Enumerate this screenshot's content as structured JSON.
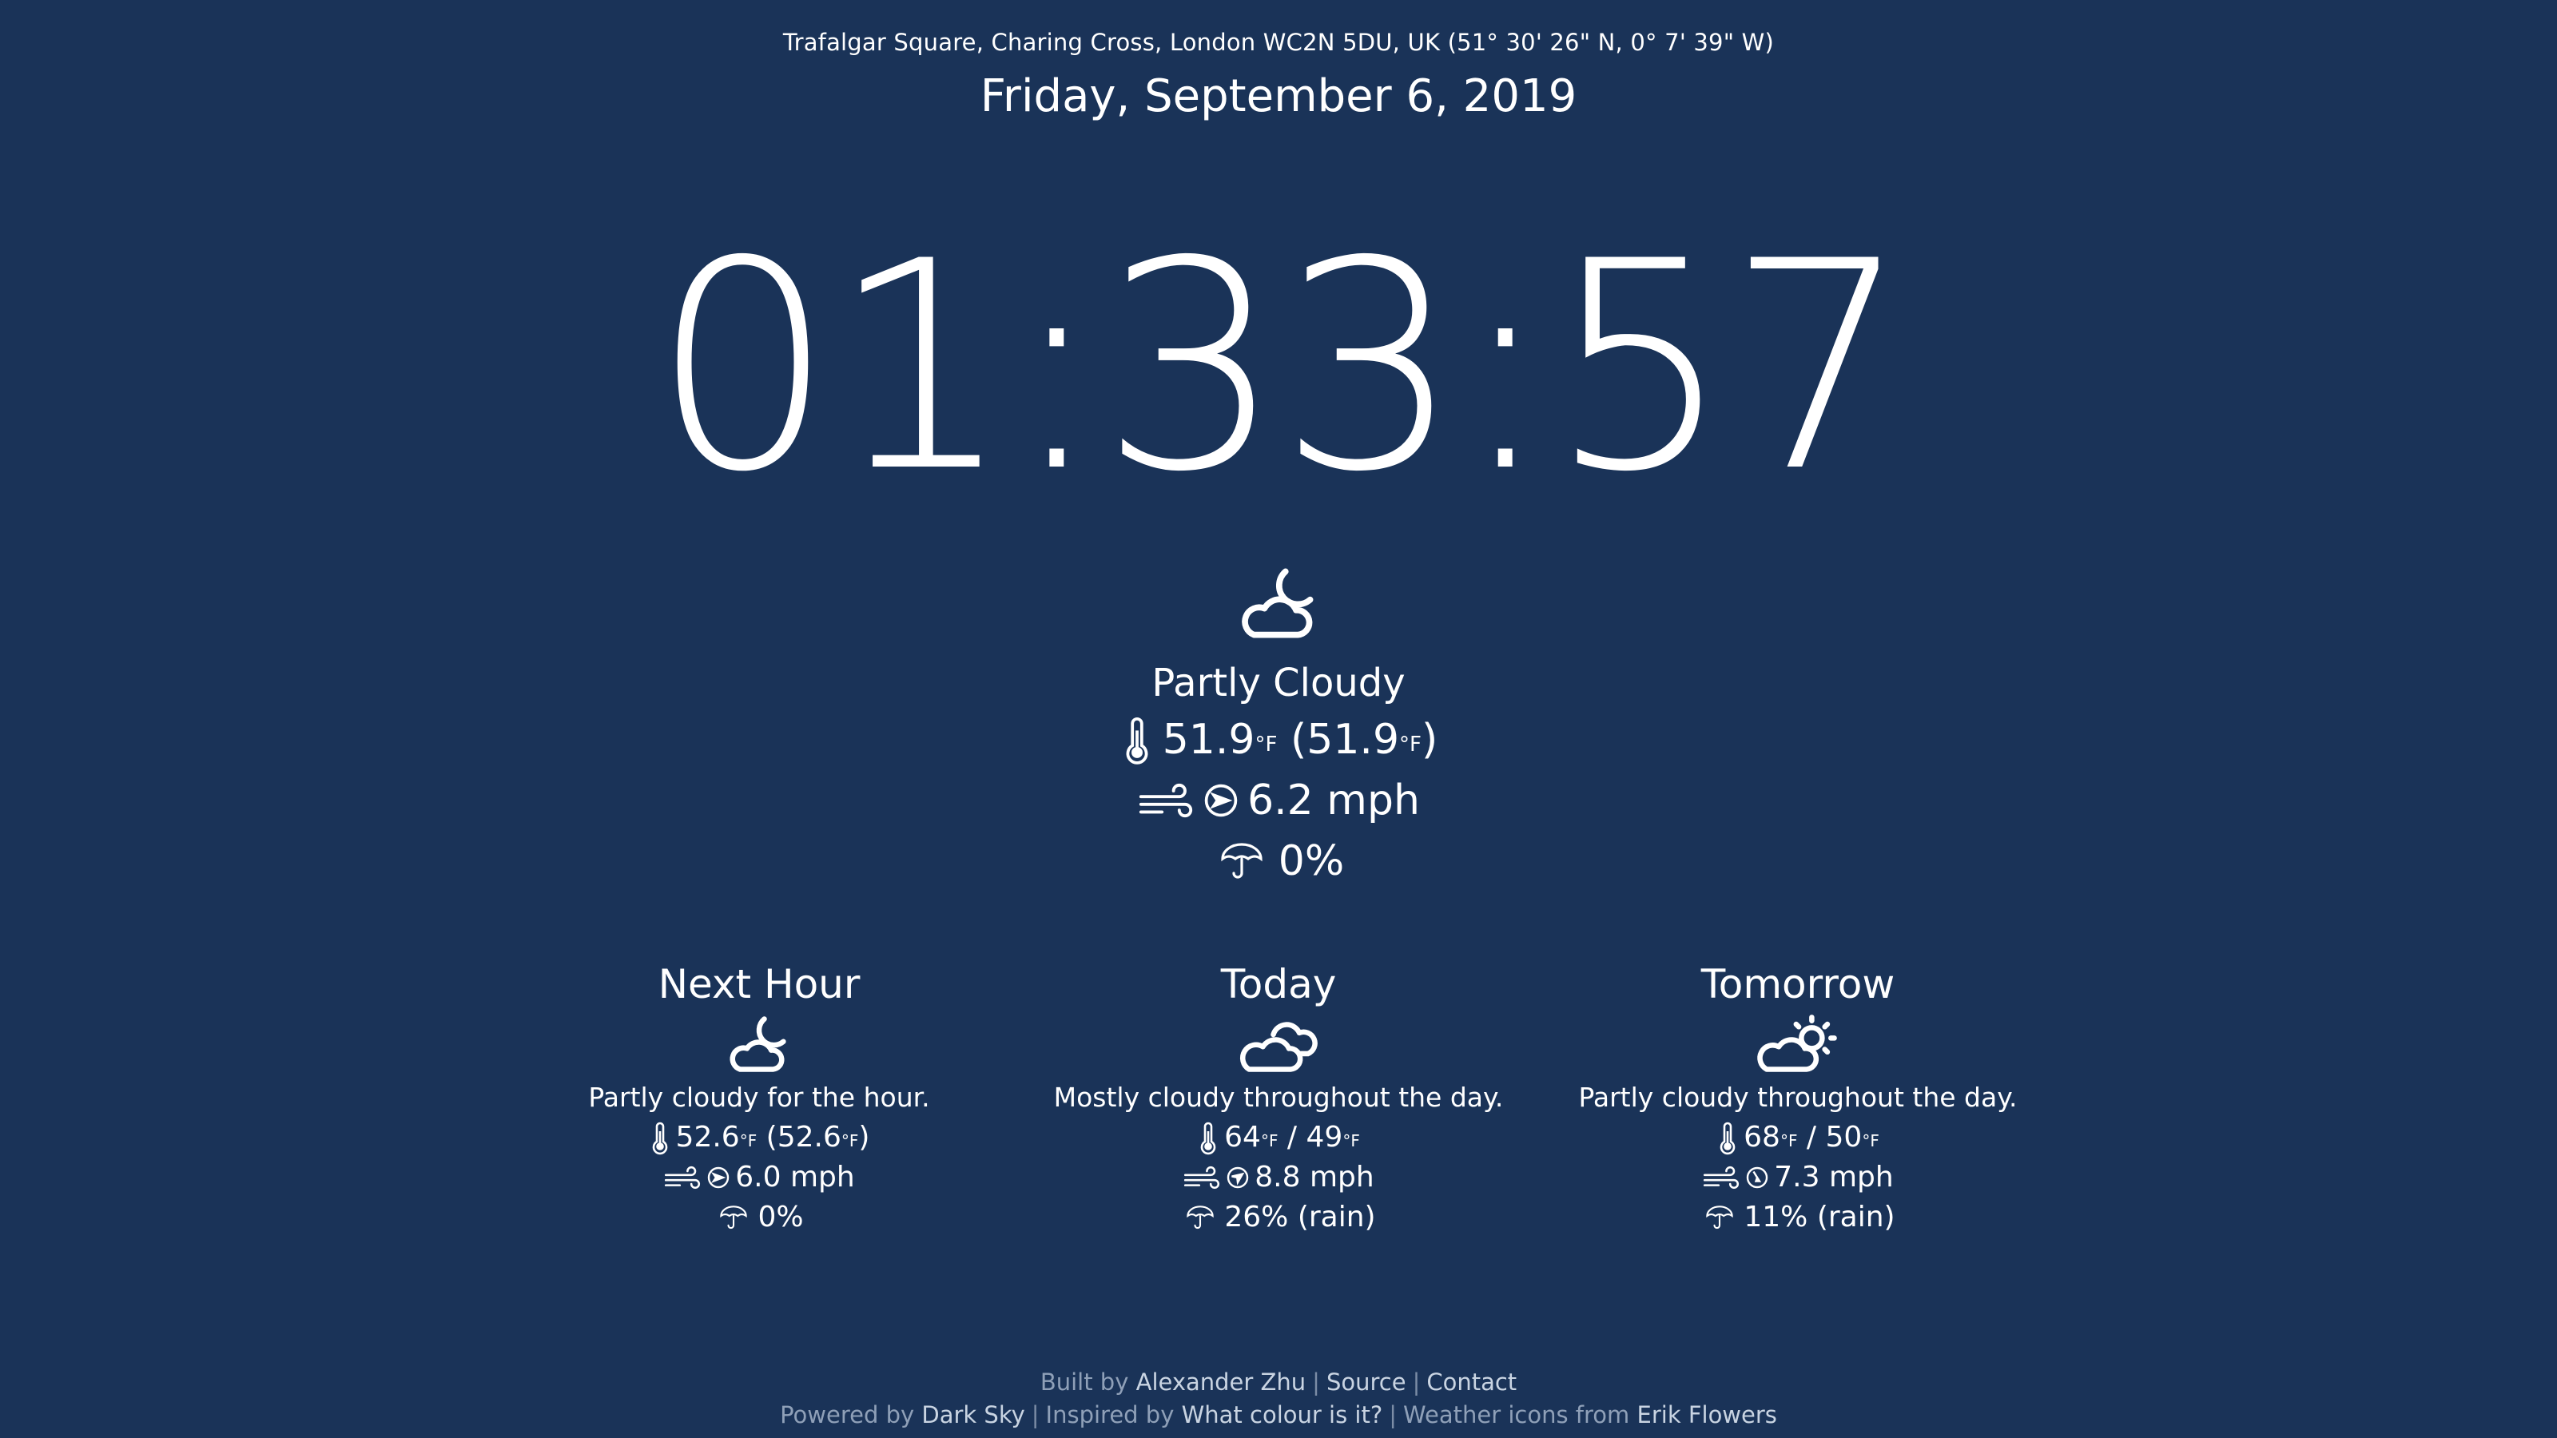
{
  "header": {
    "location": "Trafalgar Square, Charing Cross, London WC2N 5DU, UK (51° 30' 26\" N, 0° 7' 39\" W)",
    "date": "Friday, September 6, 2019"
  },
  "clock": {
    "time": "01:33:57"
  },
  "current": {
    "icon": "night-partly-cloudy-icon",
    "summary": "Partly Cloudy",
    "temperature": "51.9",
    "feels_like": "51.9",
    "temp_unit": "°F",
    "wind_speed": "6.2 mph",
    "precip": "0%"
  },
  "forecast": [
    {
      "title": "Next Hour",
      "icon": "night-partly-cloudy-icon",
      "summary": "Partly cloudy for the hour.",
      "temp_a": "52.6",
      "temp_b": "52.6",
      "temp_format": "paren",
      "wind": "6.0 mph",
      "precip": "0%"
    },
    {
      "title": "Today",
      "icon": "cloudy-icon",
      "summary": "Mostly cloudy throughout the day.",
      "temp_a": "64",
      "temp_b": "49",
      "temp_format": "slash",
      "wind": "8.8 mph",
      "precip": "26% (rain)"
    },
    {
      "title": "Tomorrow",
      "icon": "day-partly-cloudy-icon",
      "summary": "Partly cloudy throughout the day.",
      "temp_a": "68",
      "temp_b": "50",
      "temp_format": "slash",
      "wind": "7.3 mph",
      "precip": "11% (rain)"
    }
  ],
  "footer": {
    "built_by_prefix": "Built by",
    "author": "Alexander Zhu",
    "source": "Source",
    "contact": "Contact",
    "powered_by_prefix": "Powered by",
    "powered_by": "Dark Sky",
    "inspired_prefix": "Inspired by",
    "inspired": "What colour is it?",
    "icons_prefix": "Weather icons from",
    "icons_author": "Erik Flowers",
    "separator": "|"
  },
  "colors": {
    "background": "#1a3358",
    "text": "#ffffff",
    "muted": "#8fa0b8"
  }
}
